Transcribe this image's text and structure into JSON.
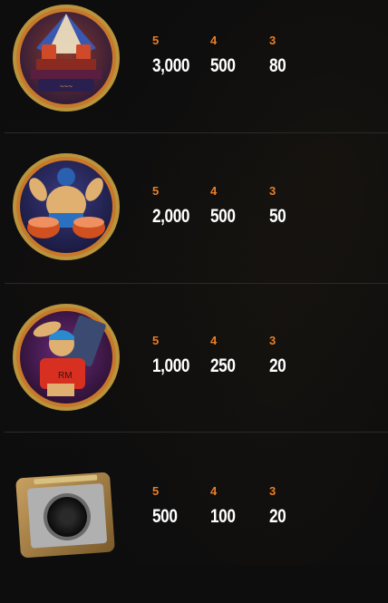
{
  "paytable": {
    "rows": [
      {
        "symbol": "stage-symbol-icon",
        "counts": [
          "5",
          "4",
          "3"
        ],
        "payouts": [
          "3,000",
          "500",
          "80"
        ]
      },
      {
        "symbol": "drummer-symbol-icon",
        "counts": [
          "5",
          "4",
          "3"
        ],
        "payouts": [
          "2,000",
          "500",
          "50"
        ]
      },
      {
        "symbol": "rocker-symbol-icon",
        "counts": [
          "5",
          "4",
          "3"
        ],
        "payouts": [
          "1,000",
          "250",
          "20"
        ]
      },
      {
        "symbol": "amplifier-symbol-icon",
        "counts": [
          "5",
          "4",
          "3"
        ],
        "payouts": [
          "500",
          "100",
          "20"
        ]
      }
    ]
  },
  "colors": {
    "background": "#0d0d0e",
    "count_text": "#e87f2a",
    "payout_text": "#ffffff",
    "divider": "#2a2a2c"
  }
}
